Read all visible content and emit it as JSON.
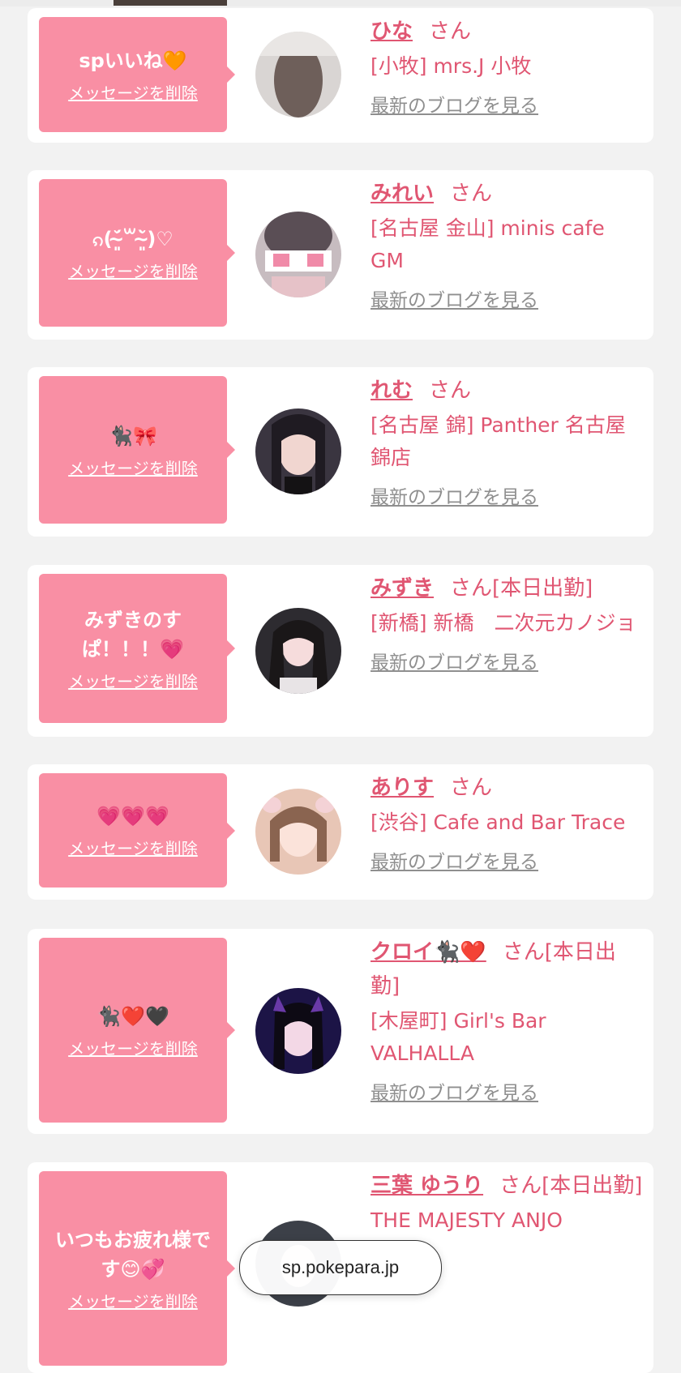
{
  "browser": {
    "url": "sp.pokepara.jp"
  },
  "common": {
    "delete_label": "メッセージを削除",
    "san": "さん",
    "blog_label": "最新のブログを見る"
  },
  "items": [
    {
      "message": "spいいね🧡",
      "name": "ひな",
      "status": "",
      "store": "[小牧] mrs.J 小牧"
    },
    {
      "message": "ၵ(˘̴͈́꒳˘̴͈̀)♡",
      "name": "みれい",
      "status": "",
      "store": "[名古屋 金山] minis cafe GM"
    },
    {
      "message": "🐈‍⬛🎀",
      "name": "れむ",
      "status": "",
      "store": "[名古屋 錦] Panther 名古屋錦店"
    },
    {
      "message": "みずきのすぱ！！！💗",
      "name": "みずき",
      "status": "[本日出勤]",
      "store": "[新橋] 新橋　二次元カノジョ"
    },
    {
      "message": "💗💗💗",
      "name": "ありす",
      "status": "",
      "store": "[渋谷] Cafe and Bar Trace"
    },
    {
      "message": "🐈‍⬛❤️🖤",
      "name": "クロイ🐈‍⬛❤️",
      "status": "[本日出勤]",
      "store": "[木屋町] Girl's Bar VALHALLA"
    },
    {
      "message": "いつもお疲れ様です😊💞",
      "name": "三葉 ゆうり",
      "status": "[本日出勤]",
      "store": "THE MAJESTY ANJO"
    }
  ]
}
